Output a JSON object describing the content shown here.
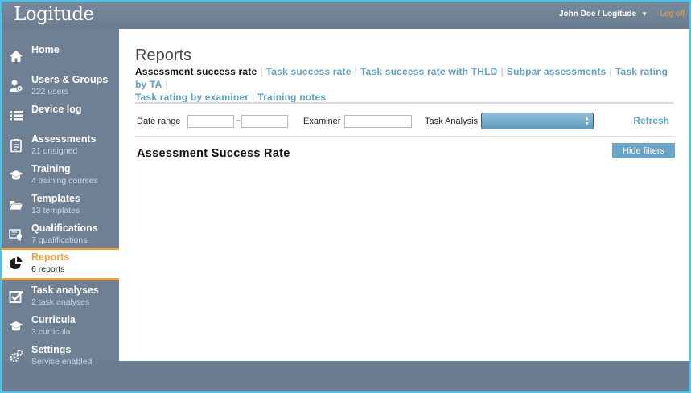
{
  "header": {
    "logo": "Logitude",
    "user": "John Doe / Logitude",
    "logoff": "Log off"
  },
  "sidebar": {
    "items": [
      {
        "label": "Home",
        "sub": "",
        "icon": "home-icon"
      },
      {
        "label": "Users & Groups",
        "sub": "222 users",
        "icon": "users-icon"
      },
      {
        "label": "Device log",
        "sub": "",
        "icon": "list-icon"
      },
      {
        "label": "Assessments",
        "sub": "21 unsigned",
        "icon": "clipboard-icon"
      },
      {
        "label": "Training",
        "sub": "4 training courses",
        "icon": "graduation-cap-icon"
      },
      {
        "label": "Templates",
        "sub": "13 templates",
        "icon": "folder-icon"
      },
      {
        "label": "Qualifications",
        "sub": "7 qualifications",
        "icon": "certificate-icon"
      },
      {
        "label": "Reports",
        "sub": "6 reports",
        "icon": "pie-chart-icon",
        "active": true
      },
      {
        "label": "Task analyses",
        "sub": "2 task analyses",
        "icon": "checkbox-icon"
      },
      {
        "label": "Curricula",
        "sub": "3 curricula",
        "icon": "graduation-cap-icon"
      },
      {
        "label": "Settings",
        "sub": "Service enabled",
        "icon": "gears-icon"
      }
    ]
  },
  "main": {
    "title": "Reports",
    "subnav": [
      "Assessment success rate",
      "Task success rate",
      "Task success rate with THLD",
      "Subpar assessments",
      "Task rating by TA",
      "Task rating by examiner",
      "Training notes"
    ],
    "filters": {
      "date_range_label": "Date range",
      "dash": "–",
      "examiner_label": "Examiner",
      "task_analysis_label": "Task Analysis",
      "refresh": "Refresh"
    },
    "section_title": "Assessment Success Rate",
    "hide_filters": "Hide filters"
  },
  "colors": {
    "accent": "#f2a23a",
    "link": "#5aa0c8",
    "sidebar": "#6f8094",
    "frame": "#3ec8ee"
  }
}
